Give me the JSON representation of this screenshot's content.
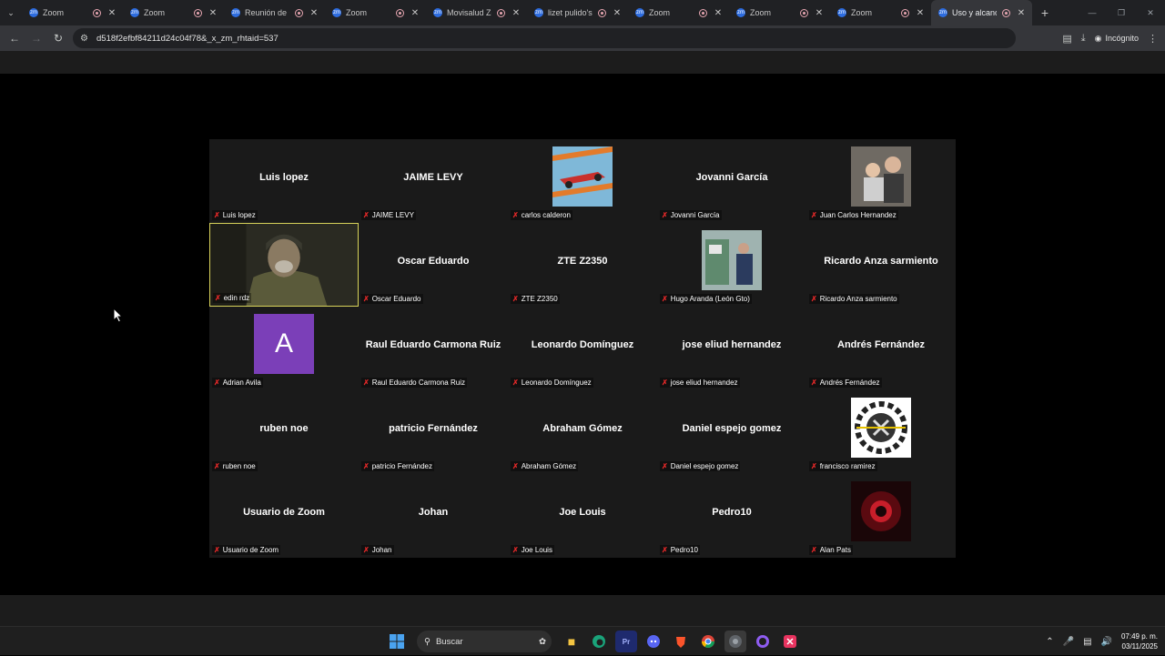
{
  "browser": {
    "tabs": [
      {
        "title": "Zoom",
        "active": false
      },
      {
        "title": "Zoom",
        "active": false
      },
      {
        "title": "Reunión de O",
        "active": false
      },
      {
        "title": "Zoom",
        "active": false
      },
      {
        "title": "Movisalud Zo",
        "active": false
      },
      {
        "title": "lizet pulido's",
        "active": false
      },
      {
        "title": "Zoom",
        "active": false
      },
      {
        "title": "Zoom",
        "active": false
      },
      {
        "title": "Zoom",
        "active": false
      },
      {
        "title": "Uso y alcance",
        "active": true
      }
    ],
    "url": "d518f2efbf84211d24c04f78&_x_zm_rhtaid=537",
    "incognito_label": "Incógnito"
  },
  "participants": [
    {
      "display": "Luis lopez",
      "label": "Luis lopez",
      "kind": "name"
    },
    {
      "display": "JAIME LEVY",
      "label": "JAIME LEVY",
      "kind": "name"
    },
    {
      "display": "",
      "label": "carlos calderon",
      "kind": "image",
      "image": "race-car"
    },
    {
      "display": "Jovanni García",
      "label": "Jovanni García",
      "kind": "name"
    },
    {
      "display": "",
      "label": "Juan Carlos Hernandez",
      "kind": "image",
      "image": "family-photo"
    },
    {
      "display": "",
      "label": "edin rdz",
      "kind": "video",
      "speaking": true
    },
    {
      "display": "Oscar Eduardo",
      "label": "Oscar Eduardo",
      "kind": "name"
    },
    {
      "display": "ZTE Z2350",
      "label": "ZTE Z2350",
      "kind": "name"
    },
    {
      "display": "",
      "label": "Hugo Aranda (León Gto)",
      "kind": "image",
      "image": "workshop-photo"
    },
    {
      "display": "Ricardo Anza sarmiento",
      "label": "Ricardo Anza sarmiento",
      "kind": "name"
    },
    {
      "display": "A",
      "label": "Adrian Avila",
      "kind": "letter",
      "color": "#7b3fb8"
    },
    {
      "display": "Raul Eduardo Carmona Ruiz",
      "label": "Raul Eduardo Carmona Ruiz",
      "kind": "name"
    },
    {
      "display": "Leonardo Domínguez",
      "label": "Leonardo Domínguez",
      "kind": "name"
    },
    {
      "display": "jose eliud hernandez",
      "label": "jose eliud hernandez",
      "kind": "name"
    },
    {
      "display": "Andrés Fernández",
      "label": "Andrés Fernández",
      "kind": "name"
    },
    {
      "display": "ruben noe",
      "label": "ruben noe",
      "kind": "name"
    },
    {
      "display": "patricio Fernández",
      "label": "patricio Fernández",
      "kind": "name"
    },
    {
      "display": "Abraham Gómez",
      "label": "Abraham Gómez",
      "kind": "name"
    },
    {
      "display": "Daniel espejo gomez",
      "label": "Daniel espejo gomez",
      "kind": "name"
    },
    {
      "display": "",
      "label": "francisco ramirez",
      "kind": "image",
      "image": "gear-logo"
    },
    {
      "display": "Usuario de Zoom",
      "label": "Usuario de Zoom",
      "kind": "name"
    },
    {
      "display": "Johan",
      "label": "Johan",
      "kind": "name"
    },
    {
      "display": "Joe Louis",
      "label": "Joe Louis",
      "kind": "name"
    },
    {
      "display": "Pedro10",
      "label": "Pedro10",
      "kind": "name"
    },
    {
      "display": "",
      "label": "Alan Pats",
      "kind": "image",
      "image": "red-badge"
    }
  ],
  "taskbar": {
    "search_label": "Buscar",
    "time": "07:49 p. m.",
    "date": "03/11/2025"
  },
  "colors": {
    "speaking_border": "#d8d35a",
    "muted_mic": "#e02828",
    "tile_bg": "#1a1a1a"
  }
}
